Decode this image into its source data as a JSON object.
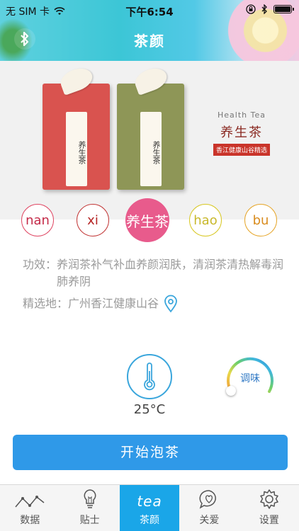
{
  "status_bar": {
    "carrier": "无 SIM 卡",
    "time": "下午6:54"
  },
  "header": {
    "title": "茶颜"
  },
  "product": {
    "caption_en": "Health Tea",
    "caption_cn": "养生茶",
    "caption_badge": "香江健康山谷精选",
    "box_label_left": "养生茶",
    "box_label_right": "养生茶"
  },
  "tea_selector": {
    "items": [
      {
        "label": "nan",
        "selected": false
      },
      {
        "label": "xi",
        "selected": false
      },
      {
        "label": "养生茶",
        "selected": true
      },
      {
        "label": "hao",
        "selected": false
      },
      {
        "label": "bu",
        "selected": false
      }
    ]
  },
  "info": {
    "efficacy_label": "功效：",
    "efficacy_value": "养润茶补气补血养颜润肤，清润茶清热解毒润肺养阴",
    "origin_label": "精选地：",
    "origin_value": "广州香江健康山谷"
  },
  "controls": {
    "temperature": "25°C",
    "flavor_label": "调味"
  },
  "start_button": {
    "label": "开始泡茶"
  },
  "tabbar": {
    "items": [
      {
        "label": "数据",
        "icon": "chart-line-icon",
        "active": false
      },
      {
        "label": "贴士",
        "icon": "lightbulb-icon",
        "active": false
      },
      {
        "label": "茶颜",
        "icon": "tea-logo-icon",
        "active": true,
        "logo_text": "tea"
      },
      {
        "label": "关爱",
        "icon": "heart-chat-icon",
        "active": false
      },
      {
        "label": "设置",
        "icon": "gear-icon",
        "active": false
      }
    ]
  },
  "colors": {
    "accent": "#2f99e8",
    "selected_tea": "#e85b8c",
    "tab_active": "#1aa6e8"
  }
}
